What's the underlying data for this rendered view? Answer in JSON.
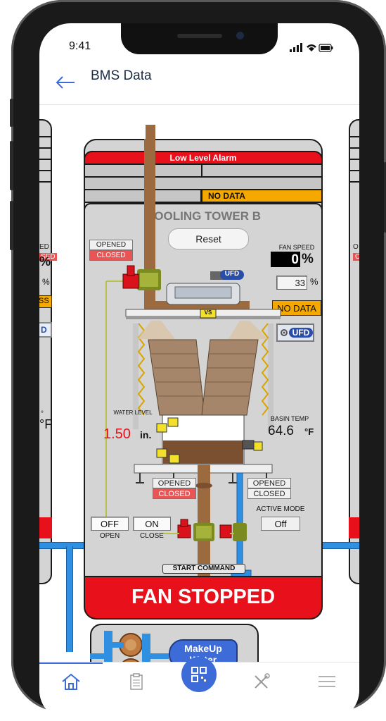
{
  "status_bar": {
    "time": "9:41"
  },
  "header": {
    "back_icon": "arrow-left-icon",
    "title": "BMS Data"
  },
  "tower": {
    "alarm_label": "Low Level Alarm",
    "no_data_label": "NO DATA",
    "title": "COOLING TOWER B",
    "reset_label": "Reset",
    "valve_top": {
      "opened": "OPENED",
      "closed": "CLOSED"
    },
    "fan_speed_label": "FAN SPEED",
    "fan_speed_value": "0",
    "fan_speed_unit": "%",
    "fan_speed_setpoint": "33",
    "fan_speed_setpoint_unit": "%",
    "fan_no_data": "NO DATA",
    "vfd_label": "UFD",
    "vs_label": "VS",
    "water_level_label": "WATER LEVEL",
    "water_level_value": "1.50",
    "water_level_unit": "in.",
    "basin_temp_label": "BASIN TEMP",
    "basin_temp_value": "64.6",
    "basin_temp_unit": "°F",
    "valve_bottom_left": {
      "opened": "OPENED",
      "closed": "CLOSED"
    },
    "valve_bottom_right": {
      "opened": "OPENED",
      "closed": "CLOSED"
    },
    "open_value": "OFF",
    "close_value": "ON",
    "open_label": "OPEN",
    "close_label": "CLOSE",
    "active_mode_label": "ACTIVE MODE",
    "active_mode_value": "Off",
    "start_command_label": "START COMMAND",
    "fan_status": "FAN STOPPED",
    "makeup_label_line1": "MakeUp",
    "makeup_label_line2": "Water"
  },
  "left_partial": {
    "ed": "ED",
    "sed": "SED",
    "pct1": "%",
    "pct2": "%",
    "ss": "SS",
    "d": "D",
    "deg_f": "°F",
    "misc": "°"
  },
  "right_partial": {
    "o": "O",
    "c": "C"
  },
  "tabbar": {
    "items": [
      {
        "icon": "home-icon",
        "active": true
      },
      {
        "icon": "clipboard-icon",
        "active": false
      },
      {
        "icon": "qr-code-icon",
        "active": false
      },
      {
        "icon": "tools-icon",
        "active": false
      },
      {
        "icon": "menu-icon",
        "active": false
      }
    ]
  },
  "colors": {
    "alarm_red": "#e8101a",
    "no_data_orange": "#f5a800",
    "pipe_blue": "#2f8fe0",
    "pipe_brown": "#9b6a3e",
    "accent_blue": "#3d6bd8",
    "panel_gray": "#d6d6d6"
  }
}
